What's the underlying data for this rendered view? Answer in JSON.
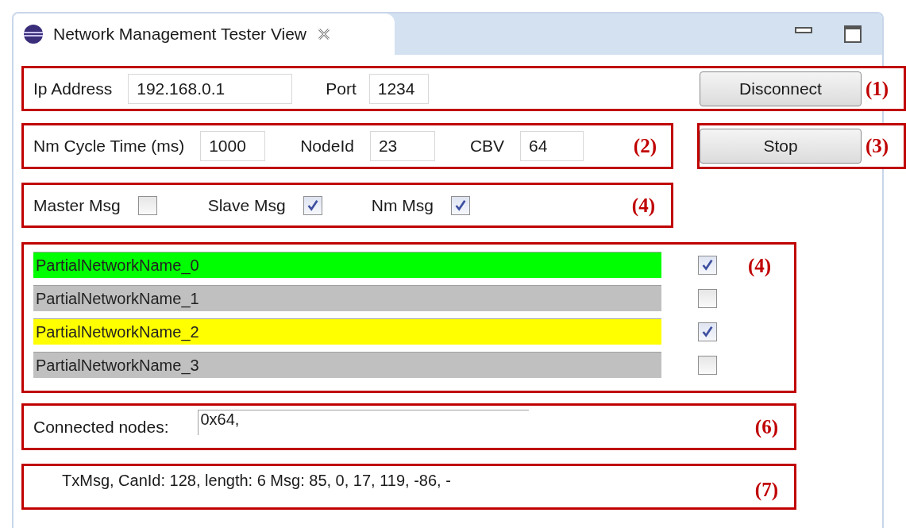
{
  "view": {
    "title": "Network Management Tester View"
  },
  "connection": {
    "ip_label": "Ip Address",
    "ip_value": "192.168.0.1",
    "port_label": "Port",
    "port_value": "1234",
    "button": "Disconnect",
    "annotation": "(1)"
  },
  "nm": {
    "fields": [
      {
        "label": "Nm Cycle Time (ms)",
        "value": "1000"
      },
      {
        "label": "NodeId",
        "value": "23"
      },
      {
        "label": "CBV",
        "value": "64"
      }
    ],
    "annotation": "(2)"
  },
  "stop": {
    "button": "Stop",
    "annotation": "(3)"
  },
  "messages": {
    "options": [
      {
        "label": "Master Msg",
        "checked": false
      },
      {
        "label": "Slave Msg",
        "checked": true
      },
      {
        "label": "Nm Msg",
        "checked": true
      }
    ],
    "annotation": "(4)"
  },
  "partial_networks": {
    "items": [
      {
        "name": "PartialNetworkName_0",
        "color": "#00ff00",
        "checked": true
      },
      {
        "name": "PartialNetworkName_1",
        "color": "#c0c0c0",
        "checked": false
      },
      {
        "name": "PartialNetworkName_2",
        "color": "#ffff00",
        "checked": true
      },
      {
        "name": "PartialNetworkName_3",
        "color": "#c0c0c0",
        "checked": false
      }
    ],
    "annotation": "(4)"
  },
  "connected": {
    "label": "Connected nodes:",
    "value": "0x64,",
    "annotation": "(6)"
  },
  "tx": {
    "text": "TxMsg, CanId: 128, length: 6 Msg: 85, 0, 17, 119, -86, -",
    "annotation": "(7)"
  }
}
